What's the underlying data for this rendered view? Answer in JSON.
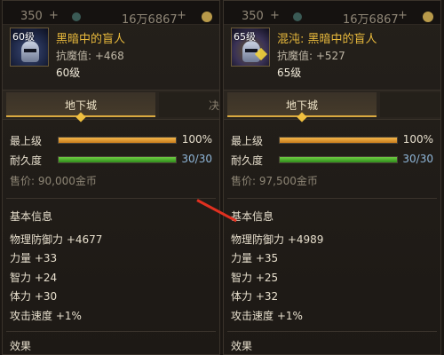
{
  "panels": [
    {
      "topbar": {
        "value_a": "350",
        "plus_a": "+",
        "value_b": "16万6867",
        "plus_b": "+"
      },
      "item": {
        "level_badge": "60级",
        "name": "黑暗中的盲人",
        "resist_label": "抗魔值: +468",
        "level": "60级"
      },
      "tabs": {
        "active": "地下城",
        "next": "决"
      },
      "max_level": {
        "label": "最上级",
        "value": "100%",
        "fill_fraction": 1.0
      },
      "durability": {
        "label": "耐久度",
        "value": "30/30",
        "fill_fraction": 1.0
      },
      "price": "售价: 90,000金币",
      "basic_title": "基本信息",
      "stats": [
        "物理防御力 +4677",
        "力量 +33",
        "智力 +24",
        "体力 +30",
        "攻击速度 +1%"
      ],
      "effect_title": "效果"
    },
    {
      "topbar": {
        "value_a": "350",
        "plus_a": "+",
        "value_b": "16万6867",
        "plus_b": "+"
      },
      "item": {
        "level_badge": "65级",
        "name": "混沌: 黑暗中的盲人",
        "resist_label": "抗魔值: +527",
        "level": "65级"
      },
      "tabs": {
        "active": "地下城",
        "next": ""
      },
      "max_level": {
        "label": "最上级",
        "value": "100%",
        "fill_fraction": 1.0
      },
      "durability": {
        "label": "耐久度",
        "value": "30/30",
        "fill_fraction": 1.0
      },
      "price": "售价: 97,500金币",
      "basic_title": "基本信息",
      "stats": [
        "物理防御力 +4989",
        "力量 +35",
        "智力 +25",
        "体力 +32",
        "攻击速度 +1%"
      ],
      "effect_title": "效果"
    }
  ],
  "colors": {
    "item_name": "#e8b93c",
    "max_bar": "#f3b64a",
    "durability_bar": "#6fcf43",
    "annotation_arrow": "#e03020"
  }
}
